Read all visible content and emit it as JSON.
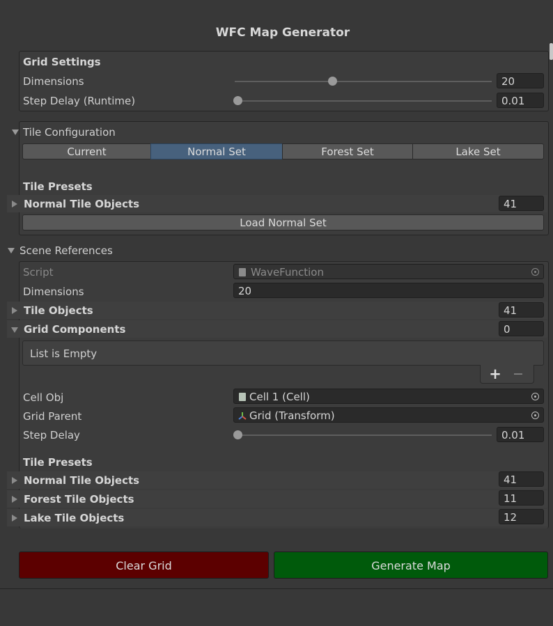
{
  "window": {
    "title": "WFC Map Generator"
  },
  "grid_settings": {
    "header": "Grid Settings",
    "dimensions_label": "Dimensions",
    "dimensions_value": "20",
    "dimensions_slider": 0.38,
    "step_delay_label": "Step Delay (Runtime)",
    "step_delay_value": "0.01",
    "step_delay_slider": 0.01
  },
  "tile_config": {
    "header": "Tile Configuration",
    "tabs": [
      "Current",
      "Normal Set",
      "Forest Set",
      "Lake Set"
    ],
    "selected_tab": "Normal Set",
    "presets_header": "Tile Presets",
    "normal_label": "Normal Tile Objects",
    "normal_count": "41",
    "load_button": "Load Normal Set"
  },
  "scene_refs": {
    "header": "Scene References",
    "script_label": "Script",
    "script_value": "WaveFunction",
    "dimensions_label": "Dimensions",
    "dimensions_value": "20",
    "tile_objects_label": "Tile Objects",
    "tile_objects_count": "41",
    "grid_components_label": "Grid Components",
    "grid_components_count": "0",
    "list_empty": "List is Empty",
    "add_symbol": "+",
    "remove_symbol": "−",
    "cell_obj_label": "Cell Obj",
    "cell_obj_value": "Cell 1 (Cell)",
    "grid_parent_label": "Grid Parent",
    "grid_parent_value": "Grid (Transform)",
    "step_delay_label": "Step Delay",
    "step_delay_value": "0.01",
    "step_delay_slider": 0.01,
    "presets_header": "Tile Presets",
    "presets": [
      {
        "label": "Normal Tile Objects",
        "count": "41"
      },
      {
        "label": "Forest Tile Objects",
        "count": "11"
      },
      {
        "label": "Lake Tile Objects",
        "count": "12"
      }
    ]
  },
  "actions": {
    "clear_label": "Clear Grid",
    "clear_color": "#5c0000",
    "generate_label": "Generate Map",
    "generate_color": "#005a0b"
  }
}
